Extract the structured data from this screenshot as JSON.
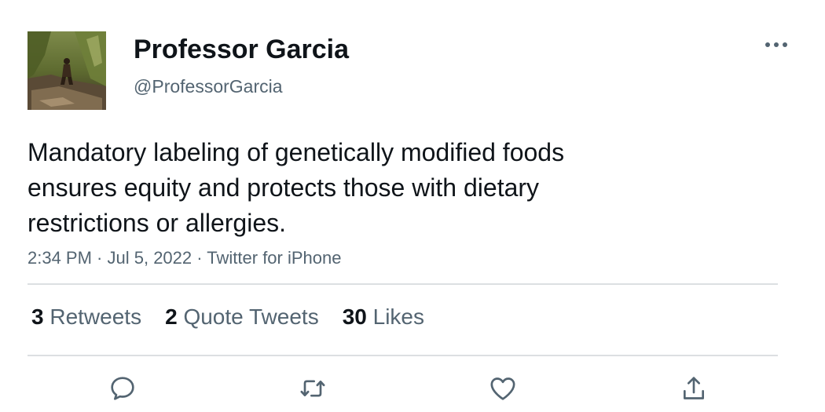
{
  "author": {
    "display_name": "Professor Garcia",
    "handle": "@ProfessorGarcia",
    "avatar_icon": "profile-photo"
  },
  "more_icon": "more-options-icon",
  "tweet": {
    "text": "Mandatory labeling of genetically modified foods ensures equity and protects those with dietary restrictions or allergies.",
    "time": "2:34 PM",
    "date": "Jul 5, 2022",
    "source": "Twitter for iPhone",
    "separator": " · "
  },
  "stats": {
    "retweets": {
      "count": "3",
      "label": "Retweets"
    },
    "quote_tweets": {
      "count": "2",
      "label": "Quote Tweets"
    },
    "likes": {
      "count": "30",
      "label": "Likes"
    }
  },
  "actions": {
    "reply_icon": "reply-icon",
    "retweet_icon": "retweet-icon",
    "like_icon": "heart-icon",
    "share_icon": "share-icon"
  },
  "colors": {
    "primary_text": "#0f1419",
    "secondary_text": "#536471",
    "divider": "#dcdfe2"
  }
}
